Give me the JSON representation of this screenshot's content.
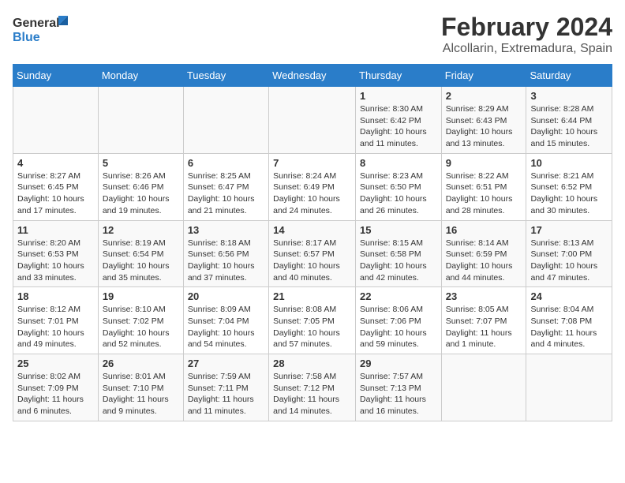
{
  "logo": {
    "line1": "General",
    "line2": "Blue"
  },
  "title": "February 2024",
  "subtitle": "Alcollarin, Extremadura, Spain",
  "days_of_week": [
    "Sunday",
    "Monday",
    "Tuesday",
    "Wednesday",
    "Thursday",
    "Friday",
    "Saturday"
  ],
  "weeks": [
    [
      {
        "day": "",
        "info": ""
      },
      {
        "day": "",
        "info": ""
      },
      {
        "day": "",
        "info": ""
      },
      {
        "day": "",
        "info": ""
      },
      {
        "day": "1",
        "info": "Sunrise: 8:30 AM\nSunset: 6:42 PM\nDaylight: 10 hours\nand 11 minutes."
      },
      {
        "day": "2",
        "info": "Sunrise: 8:29 AM\nSunset: 6:43 PM\nDaylight: 10 hours\nand 13 minutes."
      },
      {
        "day": "3",
        "info": "Sunrise: 8:28 AM\nSunset: 6:44 PM\nDaylight: 10 hours\nand 15 minutes."
      }
    ],
    [
      {
        "day": "4",
        "info": "Sunrise: 8:27 AM\nSunset: 6:45 PM\nDaylight: 10 hours\nand 17 minutes."
      },
      {
        "day": "5",
        "info": "Sunrise: 8:26 AM\nSunset: 6:46 PM\nDaylight: 10 hours\nand 19 minutes."
      },
      {
        "day": "6",
        "info": "Sunrise: 8:25 AM\nSunset: 6:47 PM\nDaylight: 10 hours\nand 21 minutes."
      },
      {
        "day": "7",
        "info": "Sunrise: 8:24 AM\nSunset: 6:49 PM\nDaylight: 10 hours\nand 24 minutes."
      },
      {
        "day": "8",
        "info": "Sunrise: 8:23 AM\nSunset: 6:50 PM\nDaylight: 10 hours\nand 26 minutes."
      },
      {
        "day": "9",
        "info": "Sunrise: 8:22 AM\nSunset: 6:51 PM\nDaylight: 10 hours\nand 28 minutes."
      },
      {
        "day": "10",
        "info": "Sunrise: 8:21 AM\nSunset: 6:52 PM\nDaylight: 10 hours\nand 30 minutes."
      }
    ],
    [
      {
        "day": "11",
        "info": "Sunrise: 8:20 AM\nSunset: 6:53 PM\nDaylight: 10 hours\nand 33 minutes."
      },
      {
        "day": "12",
        "info": "Sunrise: 8:19 AM\nSunset: 6:54 PM\nDaylight: 10 hours\nand 35 minutes."
      },
      {
        "day": "13",
        "info": "Sunrise: 8:18 AM\nSunset: 6:56 PM\nDaylight: 10 hours\nand 37 minutes."
      },
      {
        "day": "14",
        "info": "Sunrise: 8:17 AM\nSunset: 6:57 PM\nDaylight: 10 hours\nand 40 minutes."
      },
      {
        "day": "15",
        "info": "Sunrise: 8:15 AM\nSunset: 6:58 PM\nDaylight: 10 hours\nand 42 minutes."
      },
      {
        "day": "16",
        "info": "Sunrise: 8:14 AM\nSunset: 6:59 PM\nDaylight: 10 hours\nand 44 minutes."
      },
      {
        "day": "17",
        "info": "Sunrise: 8:13 AM\nSunset: 7:00 PM\nDaylight: 10 hours\nand 47 minutes."
      }
    ],
    [
      {
        "day": "18",
        "info": "Sunrise: 8:12 AM\nSunset: 7:01 PM\nDaylight: 10 hours\nand 49 minutes."
      },
      {
        "day": "19",
        "info": "Sunrise: 8:10 AM\nSunset: 7:02 PM\nDaylight: 10 hours\nand 52 minutes."
      },
      {
        "day": "20",
        "info": "Sunrise: 8:09 AM\nSunset: 7:04 PM\nDaylight: 10 hours\nand 54 minutes."
      },
      {
        "day": "21",
        "info": "Sunrise: 8:08 AM\nSunset: 7:05 PM\nDaylight: 10 hours\nand 57 minutes."
      },
      {
        "day": "22",
        "info": "Sunrise: 8:06 AM\nSunset: 7:06 PM\nDaylight: 10 hours\nand 59 minutes."
      },
      {
        "day": "23",
        "info": "Sunrise: 8:05 AM\nSunset: 7:07 PM\nDaylight: 11 hours\nand 1 minute."
      },
      {
        "day": "24",
        "info": "Sunrise: 8:04 AM\nSunset: 7:08 PM\nDaylight: 11 hours\nand 4 minutes."
      }
    ],
    [
      {
        "day": "25",
        "info": "Sunrise: 8:02 AM\nSunset: 7:09 PM\nDaylight: 11 hours\nand 6 minutes."
      },
      {
        "day": "26",
        "info": "Sunrise: 8:01 AM\nSunset: 7:10 PM\nDaylight: 11 hours\nand 9 minutes."
      },
      {
        "day": "27",
        "info": "Sunrise: 7:59 AM\nSunset: 7:11 PM\nDaylight: 11 hours\nand 11 minutes."
      },
      {
        "day": "28",
        "info": "Sunrise: 7:58 AM\nSunset: 7:12 PM\nDaylight: 11 hours\nand 14 minutes."
      },
      {
        "day": "29",
        "info": "Sunrise: 7:57 AM\nSunset: 7:13 PM\nDaylight: 11 hours\nand 16 minutes."
      },
      {
        "day": "",
        "info": ""
      },
      {
        "day": "",
        "info": ""
      }
    ]
  ]
}
